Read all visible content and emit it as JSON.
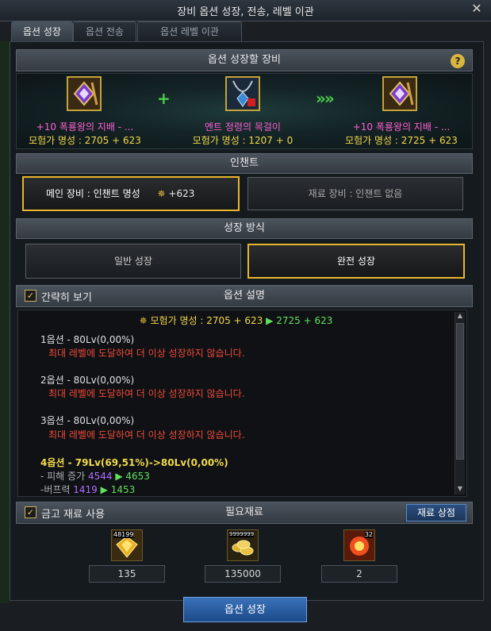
{
  "window": {
    "title": "장비 옵션 성장, 전송, 레벨 이관",
    "close_glyph": "✕"
  },
  "tabs": [
    {
      "label": "옵션 성장",
      "active": true
    },
    {
      "label": "옵션 전송",
      "active": false
    },
    {
      "label": "옵션 레벨 이관",
      "active": false
    }
  ],
  "equip_section": {
    "header": "옵션 성장할 장비",
    "help_glyph": "?",
    "plus_glyph": "+",
    "arrow_glyph": "»»",
    "slots": [
      {
        "name_prefix": "+10",
        "name": " 폭룡왕의 지배 - ...",
        "fame": "모험가 명성 : 2705 + 623",
        "icon": "blade-emblem-icon"
      },
      {
        "name_prefix": "",
        "name": "엔트 정령의 목걸이",
        "fame": "모험가 명성 : 1207 + 0",
        "icon": "necklace-icon"
      },
      {
        "name_prefix": "+10",
        "name": " 폭룡왕의 지배 - ...",
        "fame": "모험가 명성 : 2725 + 623",
        "icon": "blade-emblem-icon"
      }
    ]
  },
  "enchant_section": {
    "header": "인챈트",
    "main": "메인 장비 : 인챈트 명성",
    "main_value": "+623",
    "material": "재료 장비 : 인챈트 없음"
  },
  "growth_section": {
    "header": "성장 방식",
    "normal": "일반 성장",
    "full": "완전 성장",
    "selected": "full"
  },
  "option_section": {
    "simple_view_label": "간략히 보기",
    "simple_view_checked": true,
    "header": "옵션 설명",
    "fame_line": {
      "label": "모험가 명성 : 2705 + 623",
      "arrow": "▶",
      "result": "2725 + 623"
    },
    "options": [
      {
        "title": "1옵션 - 80Lv(0,00%)",
        "note": "최대 레벨에 도달하여 더 이상 성장하지 않습니다."
      },
      {
        "title": "2옵션 - 80Lv(0,00%)",
        "note": "최대 레벨에 도달하여 더 이상 성장하지 않습니다."
      },
      {
        "title": "3옵션 - 80Lv(0,00%)",
        "note": "최대 레벨에 도달하여 더 이상 성장하지 않습니다."
      }
    ],
    "option4": {
      "title": "4옵션 - 79Lv(69,51%)->80Lv(0,00%)",
      "stats": [
        {
          "label": "- 피해 증가",
          "from": "4544",
          "arrow": "▶",
          "to": "4653"
        },
        {
          "label": "-버프력",
          "from": "1419",
          "arrow": "▶",
          "to": "1453"
        }
      ]
    }
  },
  "materials_section": {
    "use_vault_label": "금고 재료 사용",
    "use_vault_checked": true,
    "header": "필요재료",
    "shop_button": "재료 상점",
    "items": [
      {
        "icon": "gold-crystal-icon",
        "stock": "48199",
        "required": "135"
      },
      {
        "icon": "gold-coins-icon",
        "stock": "9999999",
        "required": "135000"
      },
      {
        "icon": "fire-orb-icon",
        "stock": "32",
        "required": "2"
      }
    ]
  },
  "action_button": "옵션 성장",
  "colors": {
    "gold_border": "#e8b52e",
    "pink": "#ff5fd4",
    "green": "#62e05d",
    "red": "#f04a3a",
    "yellow": "#f2d94a"
  }
}
